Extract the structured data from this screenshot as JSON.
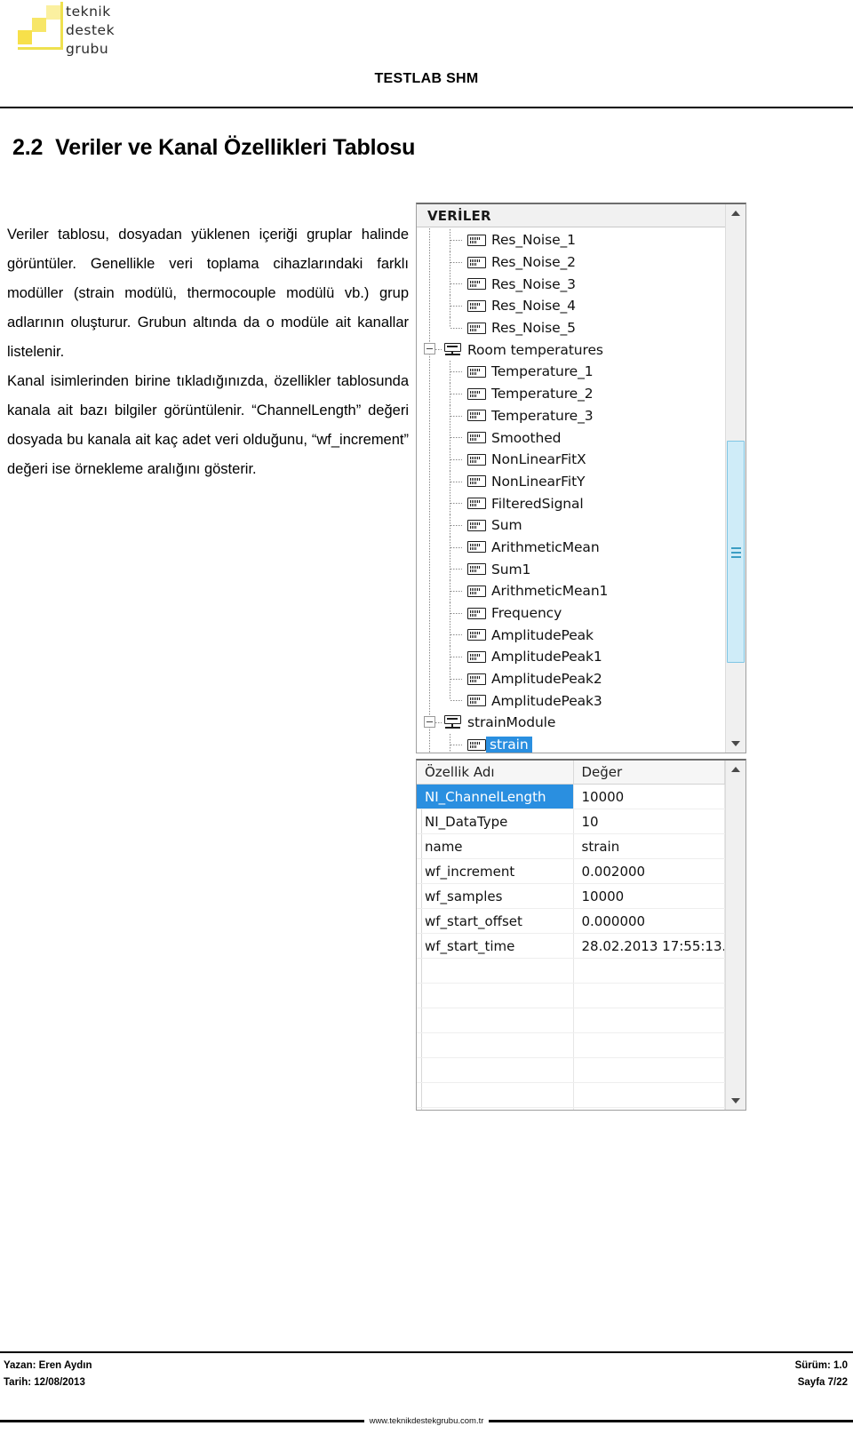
{
  "header": {
    "logo": {
      "line1": "teknik",
      "line2": "destek",
      "line3": "grubu"
    },
    "title": "TESTLAB SHM"
  },
  "section": {
    "number": "2.2",
    "title": "Veriler ve Kanal Özellikleri Tablosu"
  },
  "body": {
    "paragraph1": "Veriler tablosu, dosyadan yüklenen içeriği gruplar halinde görüntüler. Genellikle veri toplama cihazlarındaki farklı modüller (strain modülü, thermocouple modülü vb.) grup adlarının oluşturur. Grubun altında da o modüle ait kanallar listelenir.",
    "paragraph2": "Kanal isimlerinden birine tıkladığınızda, özellikler tablosunda kanala ait bazı bilgiler görüntülenir. “ChannelLength” değeri dosyada bu kanala ait kaç adet veri olduğunu, “wf_increment” değeri ise örnekleme aralığını gösterir."
  },
  "tree": {
    "header": "VERİLER",
    "rows": [
      {
        "label": "Res_Noise_1",
        "type": "channel",
        "level": 1,
        "selected": false,
        "last": false
      },
      {
        "label": "Res_Noise_2",
        "type": "channel",
        "level": 1,
        "selected": false,
        "last": false
      },
      {
        "label": "Res_Noise_3",
        "type": "channel",
        "level": 1,
        "selected": false,
        "last": false
      },
      {
        "label": "Res_Noise_4",
        "type": "channel",
        "level": 1,
        "selected": false,
        "last": false
      },
      {
        "label": "Res_Noise_5",
        "type": "channel",
        "level": 1,
        "selected": false,
        "last": true
      },
      {
        "label": "Room temperatures",
        "type": "group",
        "level": 0,
        "selected": false,
        "last": false
      },
      {
        "label": "Temperature_1",
        "type": "channel",
        "level": 1,
        "selected": false,
        "last": false
      },
      {
        "label": "Temperature_2",
        "type": "channel",
        "level": 1,
        "selected": false,
        "last": false
      },
      {
        "label": "Temperature_3",
        "type": "channel",
        "level": 1,
        "selected": false,
        "last": false
      },
      {
        "label": "Smoothed",
        "type": "channel",
        "level": 1,
        "selected": false,
        "last": false
      },
      {
        "label": "NonLinearFitX",
        "type": "channel",
        "level": 1,
        "selected": false,
        "last": false
      },
      {
        "label": "NonLinearFitY",
        "type": "channel",
        "level": 1,
        "selected": false,
        "last": false
      },
      {
        "label": "FilteredSignal",
        "type": "channel",
        "level": 1,
        "selected": false,
        "last": false
      },
      {
        "label": "Sum",
        "type": "channel",
        "level": 1,
        "selected": false,
        "last": false
      },
      {
        "label": "ArithmeticMean",
        "type": "channel",
        "level": 1,
        "selected": false,
        "last": false
      },
      {
        "label": "Sum1",
        "type": "channel",
        "level": 1,
        "selected": false,
        "last": false
      },
      {
        "label": "ArithmeticMean1",
        "type": "channel",
        "level": 1,
        "selected": false,
        "last": false
      },
      {
        "label": "Frequency",
        "type": "channel",
        "level": 1,
        "selected": false,
        "last": false
      },
      {
        "label": "AmplitudePeak",
        "type": "channel",
        "level": 1,
        "selected": false,
        "last": false
      },
      {
        "label": "AmplitudePeak1",
        "type": "channel",
        "level": 1,
        "selected": false,
        "last": false
      },
      {
        "label": "AmplitudePeak2",
        "type": "channel",
        "level": 1,
        "selected": false,
        "last": false
      },
      {
        "label": "AmplitudePeak3",
        "type": "channel",
        "level": 1,
        "selected": false,
        "last": true
      },
      {
        "label": "strainModule",
        "type": "group",
        "level": 0,
        "selected": false,
        "last": false
      },
      {
        "label": "strain",
        "type": "channel",
        "level": 1,
        "selected": true,
        "last": false
      }
    ],
    "selection_color": "#2a8fe0",
    "scrollbar": {
      "up_icon": "caret-up-icon",
      "down_icon": "caret-down-icon"
    }
  },
  "properties": {
    "columns": [
      "Özellik Adı",
      "Değer"
    ],
    "rows": [
      {
        "name": "NI_ChannelLength",
        "value": "10000",
        "selected": true
      },
      {
        "name": "NI_DataType",
        "value": "10",
        "selected": false
      },
      {
        "name": "name",
        "value": "strain",
        "selected": false
      },
      {
        "name": "wf_increment",
        "value": "0.002000",
        "selected": false
      },
      {
        "name": "wf_samples",
        "value": "10000",
        "selected": false
      },
      {
        "name": "wf_start_offset",
        "value": "0.000000",
        "selected": false
      },
      {
        "name": "wf_start_time",
        "value": "28.02.2013 17:55:13.",
        "selected": false
      }
    ],
    "empty_row_count": 11,
    "scrollbar": {
      "up_icon": "caret-up-icon",
      "down_icon": "caret-down-icon"
    }
  },
  "footer": {
    "author": "Yazan: Eren Aydın",
    "date": "Tarih: 12/08/2013",
    "version": "Sürüm: 1.0",
    "page": "Sayfa 7/22",
    "url": "www.teknikdestekgrubu.com.tr"
  }
}
